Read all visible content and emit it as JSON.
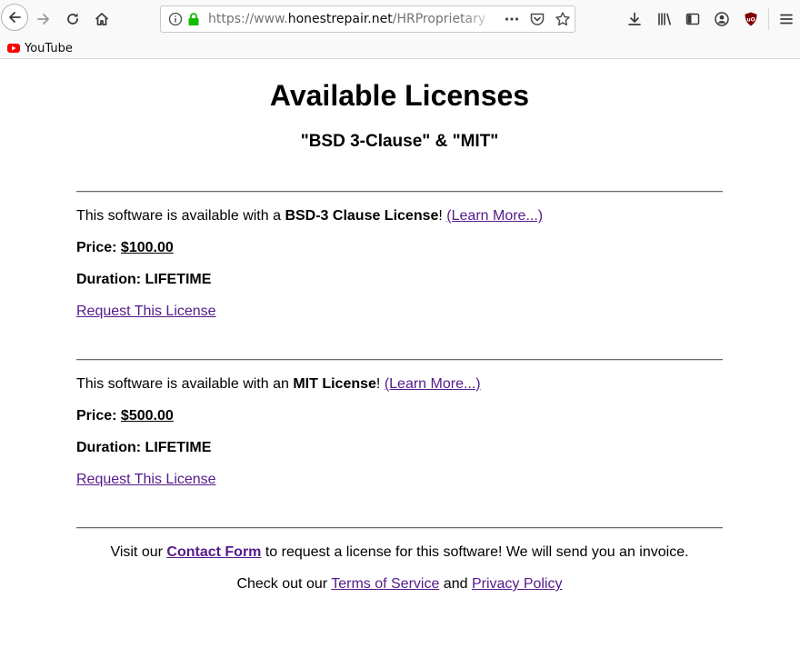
{
  "browser": {
    "url_prefix": "https://www.",
    "url_host": "honestrepair.net",
    "url_path": "/HRProprietary",
    "bookmarks": [
      {
        "label": "YouTube",
        "icon": "youtube-icon"
      }
    ]
  },
  "header": {
    "title": "Available Licenses",
    "subtitle": "\"BSD 3-Clause\" & \"MIT\""
  },
  "licenses": [
    {
      "intro": "This software is available with a ",
      "name": "BSD-3 Clause License",
      "exclaim": "!",
      "learn_more": "(Learn More...)",
      "price_label": "Price:",
      "price_value": "$100.00",
      "duration": "Duration: LIFETIME",
      "request": "Request This License"
    },
    {
      "intro": "This software is available with an ",
      "name": "MIT License",
      "exclaim": "!",
      "learn_more": "(Learn More...)",
      "price_label": "Price:",
      "price_value": "$500.00",
      "duration": "Duration: LIFETIME",
      "request": "Request This License"
    }
  ],
  "footer": {
    "visit_prefix": "Visit our ",
    "contact_link": "Contact Form",
    "visit_suffix": " to request a license for this software! We will send you an invoice.",
    "check_prefix": "Check out our ",
    "tos_link": "Terms of Service",
    "and": " and ",
    "privacy_link": "Privacy Policy"
  },
  "colors": {
    "link": "#551a8b",
    "secure_lock": "#12bc00",
    "ublock": "#800000"
  }
}
